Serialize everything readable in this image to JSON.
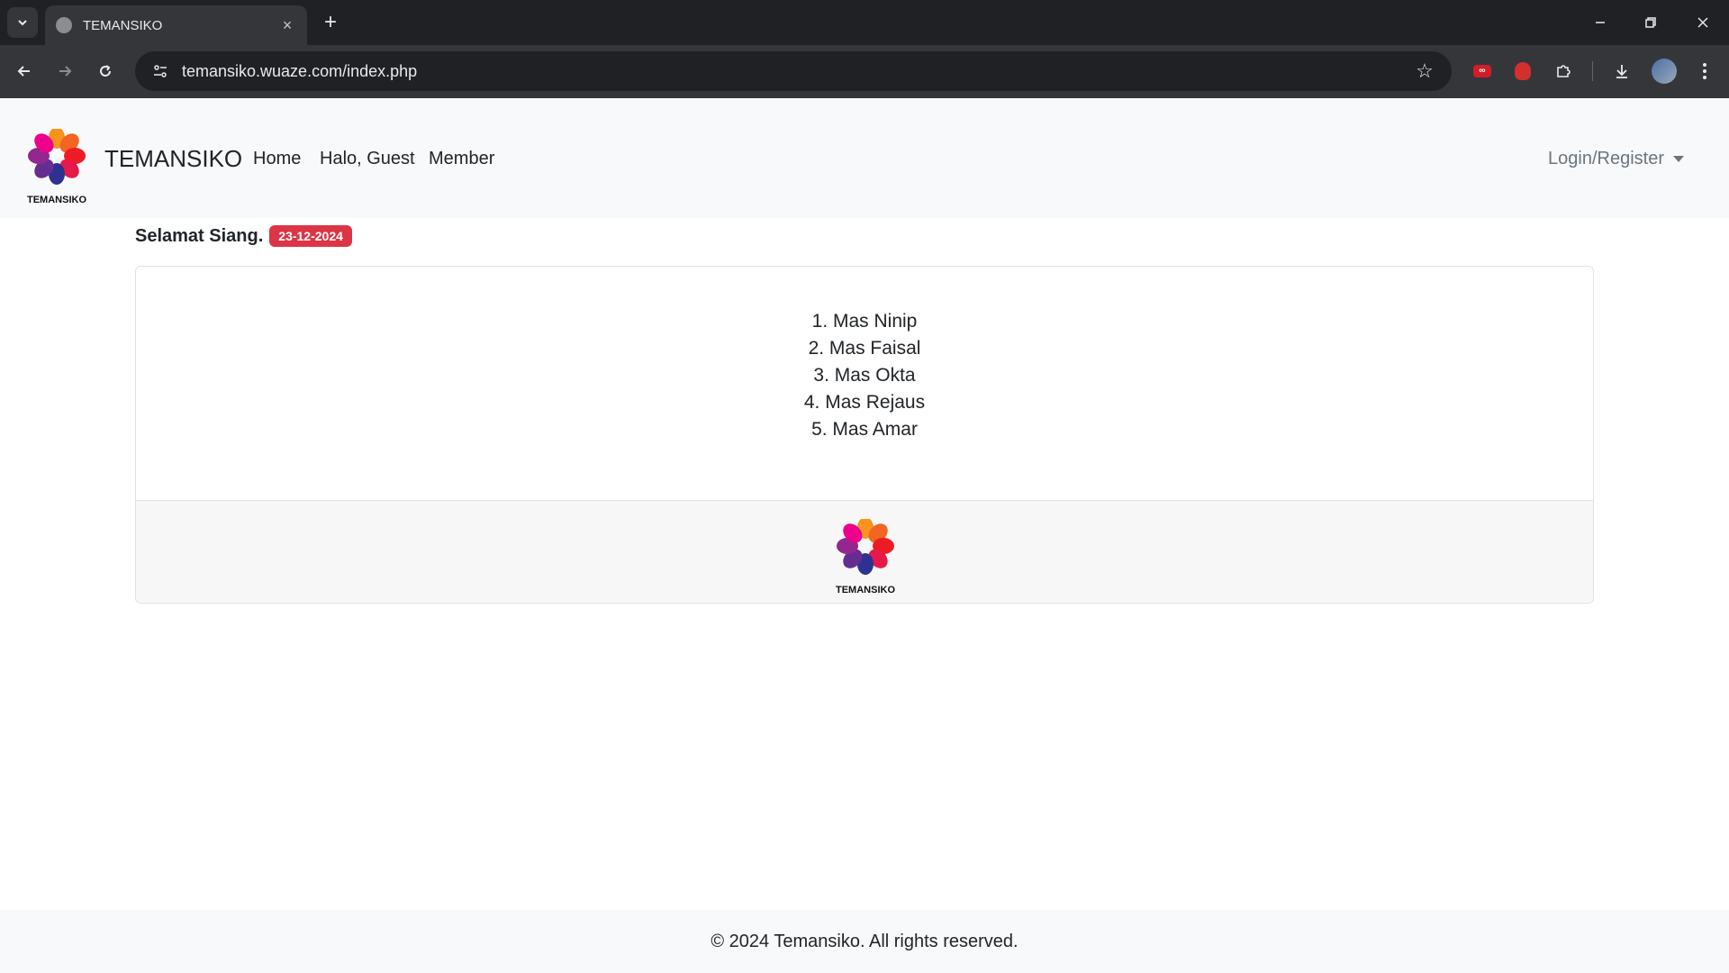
{
  "browser": {
    "tab_title": "TEMANSIKO",
    "url": "temansiko.wuaze.com/index.php",
    "extension_badge": "∞"
  },
  "navbar": {
    "logo_caption": "TEMANSIKO",
    "brand": "TEMANSIKO",
    "links": [
      "Home",
      "Halo, Guest",
      "Member"
    ],
    "login_label": "Login/Register"
  },
  "greeting": {
    "text": "Selamat Siang.",
    "date": "23-12-2024"
  },
  "members": [
    "1. Mas Ninip",
    "2. Mas Faisal",
    "3. Mas Okta",
    "4. Mas Rejaus",
    "5. Mas Amar"
  ],
  "card_footer": {
    "logo_caption": "TEMANSIKO"
  },
  "footer": {
    "copyright": "© 2024 Temansiko. All rights reserved."
  },
  "colors": {
    "badge": "#dc3545",
    "navbar_bg": "#f8f9fa",
    "chrome_dark": "#202124",
    "chrome_toolbar": "#35363a"
  }
}
